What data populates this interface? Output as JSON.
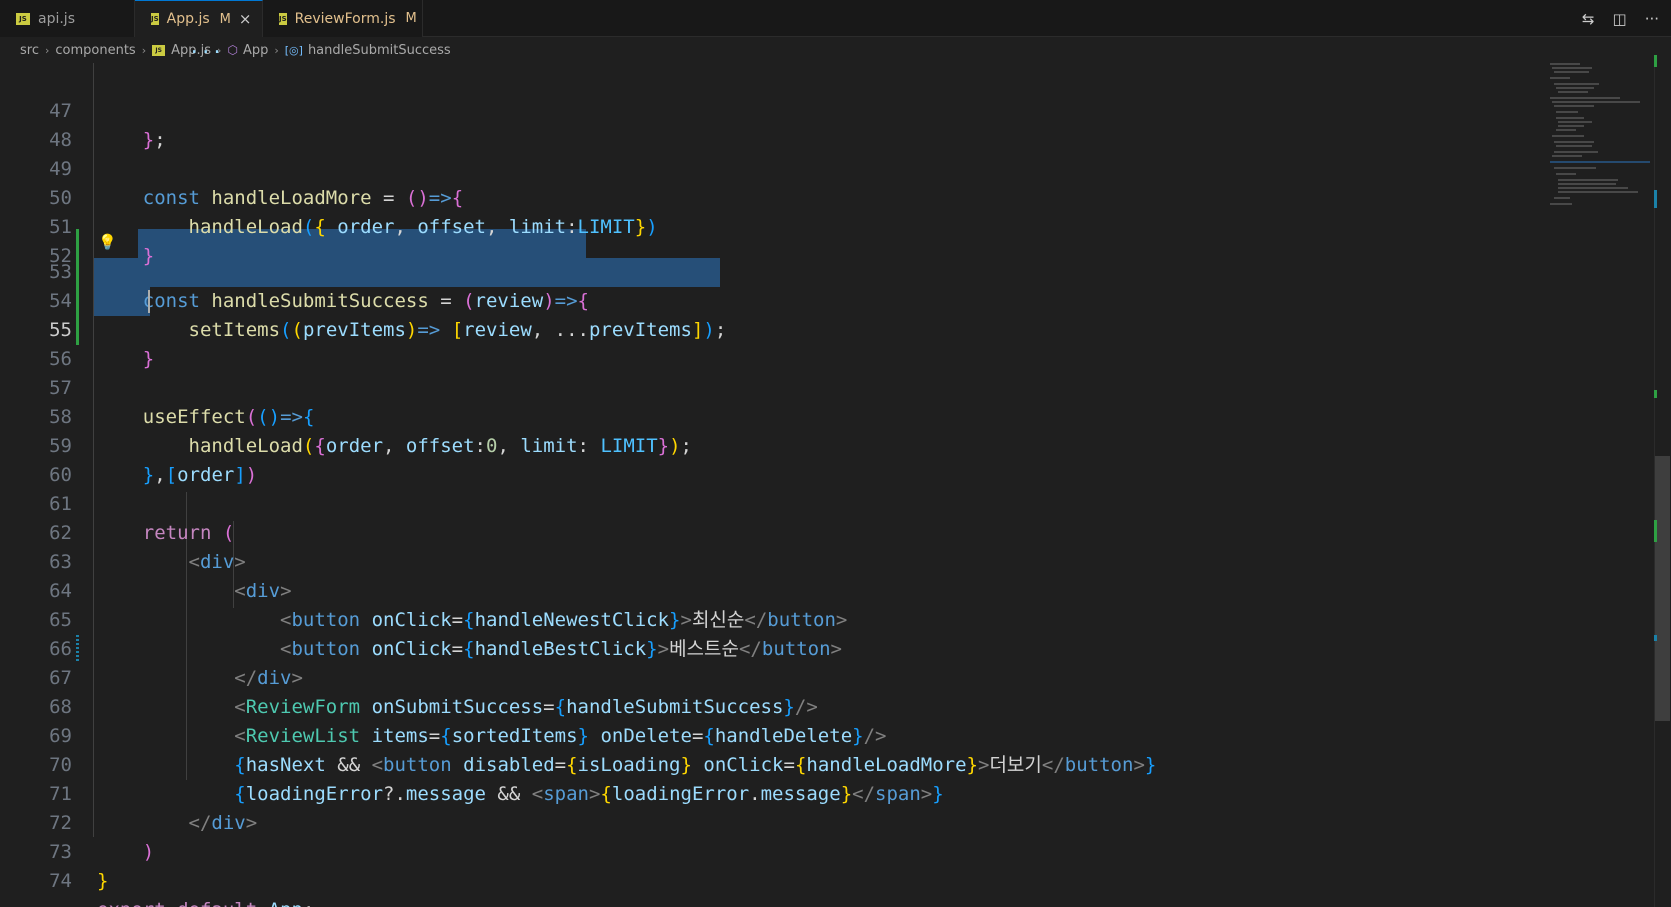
{
  "tabs": [
    {
      "label": "api.js",
      "badge": "JS",
      "modified": ""
    },
    {
      "label": "App.js",
      "badge": "JS",
      "modified": "M",
      "active": true
    },
    {
      "label": "ReviewForm.js",
      "badge": "JS",
      "modified": "M"
    }
  ],
  "icons": {
    "tab_close": "×",
    "compare": "⇆",
    "split": "◫",
    "more": "···",
    "lightbulb": "💡",
    "chevron": "›"
  },
  "breadcrumb": {
    "items": [
      "src",
      "components",
      "App.js",
      "App",
      "handleSubmitSuccess"
    ]
  },
  "editor": {
    "current_line": 55,
    "line_numbers": [
      "47",
      "48",
      "49",
      "50",
      "51",
      "52",
      "53",
      "54",
      "55",
      "56",
      "57",
      "58",
      "59",
      "60",
      "61",
      "62",
      "63",
      "64",
      "65",
      "66",
      "67",
      "68",
      "69",
      "70",
      "71",
      "72",
      "73",
      "74"
    ]
  },
  "colors": {
    "background": "#1f1f1f",
    "selection": "#264f78",
    "git_added": "#2ea043",
    "keyword": "#569cd6",
    "function": "#dcdcaa",
    "variable": "#9cdcfe"
  }
}
